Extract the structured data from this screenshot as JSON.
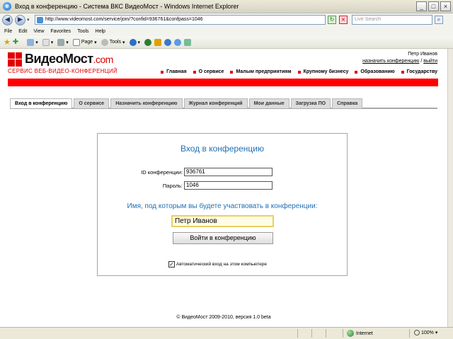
{
  "window": {
    "title": "Вход в конференцию - Система ВКС ВидеоМост - Windows Internet Explorer",
    "controls": [
      "_",
      "□",
      "×"
    ]
  },
  "address_bar": {
    "url": "http://www.videomost.com/service/join/?confid=936761&confpass=1046",
    "search_placeholder": "Live Search"
  },
  "menu": [
    "File",
    "Edit",
    "View",
    "Favorites",
    "Tools",
    "Help"
  ],
  "command_bar": {
    "page_label": "Page",
    "tools_label": "Tools"
  },
  "site": {
    "logo_main": "ВидеоМост",
    "logo_suffix": ".com",
    "tagline": "СЕРВИС ВЕБ-ВИДЕО-КОНФЕРЕНЦИЙ",
    "user_name": "Петр Иванов",
    "schedule_link": "назначить конференцию",
    "separator": "/",
    "logout_link": "выйти",
    "top_nav": [
      "Главная",
      "О сервисе",
      "Малым предприятиям",
      "Крупному бизнесу",
      "Образованию",
      "Государству"
    ],
    "brand_color": "#e10000"
  },
  "tabs": [
    {
      "label": "Вход в конференцию",
      "active": true
    },
    {
      "label": "О сервисе",
      "active": false
    },
    {
      "label": "Назначить конференцию",
      "active": false
    },
    {
      "label": "Журнал конференций",
      "active": false
    },
    {
      "label": "Мои данные",
      "active": false
    },
    {
      "label": "Загрузка ПО",
      "active": false
    },
    {
      "label": "Справка",
      "active": false
    }
  ],
  "login": {
    "title": "Вход в конференцию",
    "conf_id_label": "ID конференции:",
    "conf_id_value": "936761",
    "password_label": "Пароль:",
    "password_value": "1046",
    "name_prompt": "Имя, под которым вы будете участвовать в конференции:",
    "name_value": "Петр Иванов",
    "submit_label": "Войти в конференцию",
    "auto_login_label": "Автоматический вход на этом компьютере",
    "auto_login_checked": true
  },
  "footer": "© ВидеоМост 2009-2010, версия 1.0 beta",
  "status_bar": {
    "zone": "Internet",
    "zoom": "100%"
  }
}
